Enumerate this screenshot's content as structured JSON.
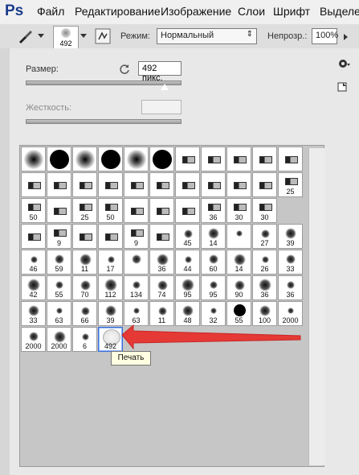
{
  "app": {
    "logo": "Ps"
  },
  "menubar": {
    "items": [
      "Файл",
      "Редактирование",
      "Изображение",
      "Слои",
      "Шрифт",
      "Выделен"
    ]
  },
  "options": {
    "brush_size": "492",
    "mode_label": "Режим:",
    "mode_value": "Нормальный",
    "opacity_label": "Непрозр.:",
    "opacity_value": "100%"
  },
  "panel": {
    "size_label": "Размер:",
    "size_value": "492 пикс.",
    "hardness_label": "Жесткость:",
    "hardness_value": "",
    "size_slider_fraction": 0.89
  },
  "brushes": [
    [
      "",
      "",
      "",
      "",
      "",
      "",
      "",
      "",
      "",
      "",
      ""
    ],
    [
      "",
      "",
      "",
      "",
      "",
      "",
      "",
      "",
      "",
      "",
      "25"
    ],
    [
      "50",
      "",
      "25",
      "50",
      "",
      "",
      "",
      "36",
      "30",
      "30"
    ],
    [
      "",
      "9",
      "",
      "",
      "9",
      "",
      "45",
      "14",
      "",
      "27",
      "39"
    ],
    [
      "46",
      "59",
      "11",
      "17",
      "",
      "36",
      "44",
      "60",
      "14",
      "26",
      "33"
    ],
    [
      "42",
      "55",
      "70",
      "112",
      "134",
      "74",
      "95",
      "95",
      "90",
      "36",
      "36"
    ],
    [
      "33",
      "63",
      "66",
      "39",
      "63",
      "11",
      "48",
      "32",
      "55",
      "100",
      "2000"
    ],
    [
      "2000",
      "2000",
      "6",
      "492"
    ]
  ],
  "tooltip": "Печать",
  "colors": {
    "accent": "#e53935",
    "ps_blue": "#1b3c8c"
  }
}
